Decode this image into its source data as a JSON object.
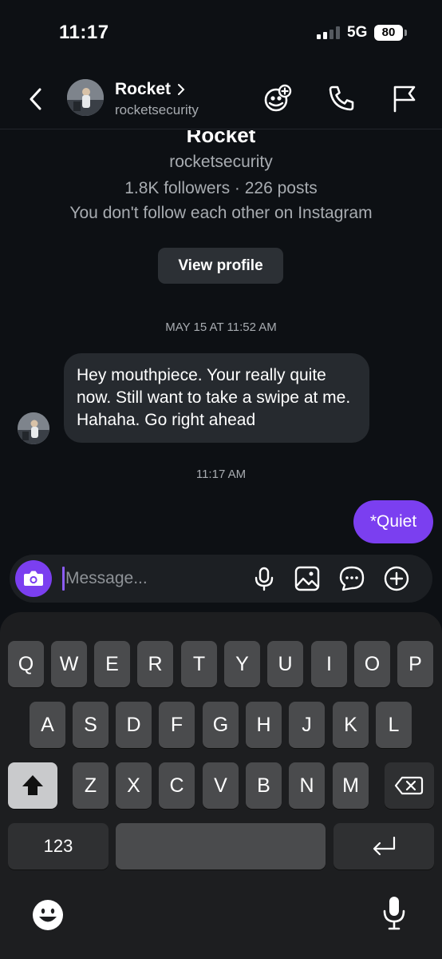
{
  "status_bar": {
    "time": "11:17",
    "network": "5G",
    "battery": "80"
  },
  "header": {
    "name": "Rocket",
    "handle": "rocketsecurity"
  },
  "profile_card": {
    "name": "Rocket",
    "handle": "rocketsecurity",
    "stats": "1.8K followers · 226 posts",
    "follow_note": "You don't follow each other on Instagram",
    "view_profile_label": "View profile"
  },
  "messages": [
    {
      "type": "timestamp",
      "text": "MAY 15 AT 11:52 AM"
    },
    {
      "type": "incoming",
      "text": "Hey mouthpiece. Your really quite now. Still want to take a swipe at me.  Hahaha.  Go right ahead"
    },
    {
      "type": "timestamp",
      "text": "11:17 AM"
    },
    {
      "type": "outgoing",
      "text": "*Quiet"
    }
  ],
  "composer": {
    "placeholder": "Message..."
  },
  "keyboard": {
    "row1": [
      "Q",
      "W",
      "E",
      "R",
      "T",
      "Y",
      "U",
      "I",
      "O",
      "P"
    ],
    "row2": [
      "A",
      "S",
      "D",
      "F",
      "G",
      "H",
      "J",
      "K",
      "L"
    ],
    "row3": [
      "Z",
      "X",
      "C",
      "V",
      "B",
      "N",
      "M"
    ],
    "numbers_label": "123"
  },
  "icons": {
    "header": [
      "back-icon",
      "add-people-icon",
      "phone-icon",
      "flag-icon"
    ],
    "composer": [
      "camera-icon",
      "microphone-icon",
      "gallery-icon",
      "sticker-chat-icon",
      "plus-circle-icon"
    ],
    "keyboard": [
      "shift-icon",
      "backspace-icon",
      "return-icon",
      "emoji-icon",
      "dictation-icon"
    ]
  },
  "colors": {
    "accent": "#7b3ff0",
    "background": "#0d1014",
    "bubble_incoming": "#262a2f"
  }
}
